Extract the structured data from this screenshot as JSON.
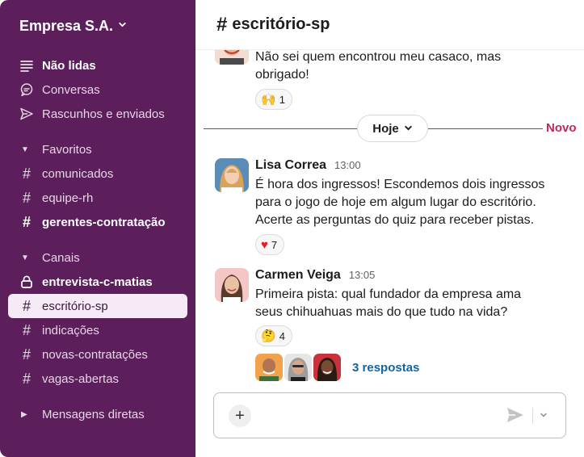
{
  "workspace": {
    "name": "Empresa S.A.",
    "chevron": "⌄"
  },
  "sidebar": {
    "top_items": [
      {
        "label": "Não lidas",
        "icon": "unread-lines-icon"
      },
      {
        "label": "Conversas",
        "icon": "threads-bubble-icon"
      },
      {
        "label": "Rascunhos e enviados",
        "icon": "send-paper-plane-icon"
      }
    ],
    "favorites": {
      "label": "Favoritos",
      "channels": [
        "comunicados",
        "equipe-rh",
        "gerentes-contratação"
      ]
    },
    "channels": {
      "label": "Canais",
      "items": [
        "entrevista-c-matias",
        "escritório-sp",
        "indicações",
        "novas-contratações",
        "vagas-abertas"
      ]
    },
    "dms": {
      "label": "Mensagens diretas"
    }
  },
  "channel": {
    "hash": "#",
    "name": "escritório-sp"
  },
  "messages": {
    "prev": {
      "text_line1": "Não sei quem encontrou meu casaco, mas",
      "text_line2": "obrigado!",
      "reaction_emoji": "🙌",
      "reaction_count": "1"
    },
    "divider": {
      "label": "Hoje",
      "new_label": "Novo"
    },
    "lisa": {
      "name": "Lisa Correa",
      "time": "13:00",
      "line1": "É hora dos ingressos! Escondemos dois ingressos",
      "line2": "para o jogo de hoje em algum lugar do escritório.",
      "line3": "Acerte as perguntas do quiz para receber pistas.",
      "reaction_emoji": "❤️",
      "reaction_count": "7"
    },
    "carmen": {
      "name": "Carmen Veiga",
      "time": "13:05",
      "line1": "Primeira pista: qual fundador da empresa ama",
      "line2": "seus chihuahuas mais do que tudo na vida?",
      "reaction_emoji": "🤔",
      "reaction_count": "4",
      "replies": "3 respostas"
    }
  },
  "composer": {
    "plus": "+",
    "placeholder": ""
  },
  "colors": {
    "sidebar": "#5d1f5c",
    "new_divider": "#c1275a",
    "link": "#1264a3"
  }
}
